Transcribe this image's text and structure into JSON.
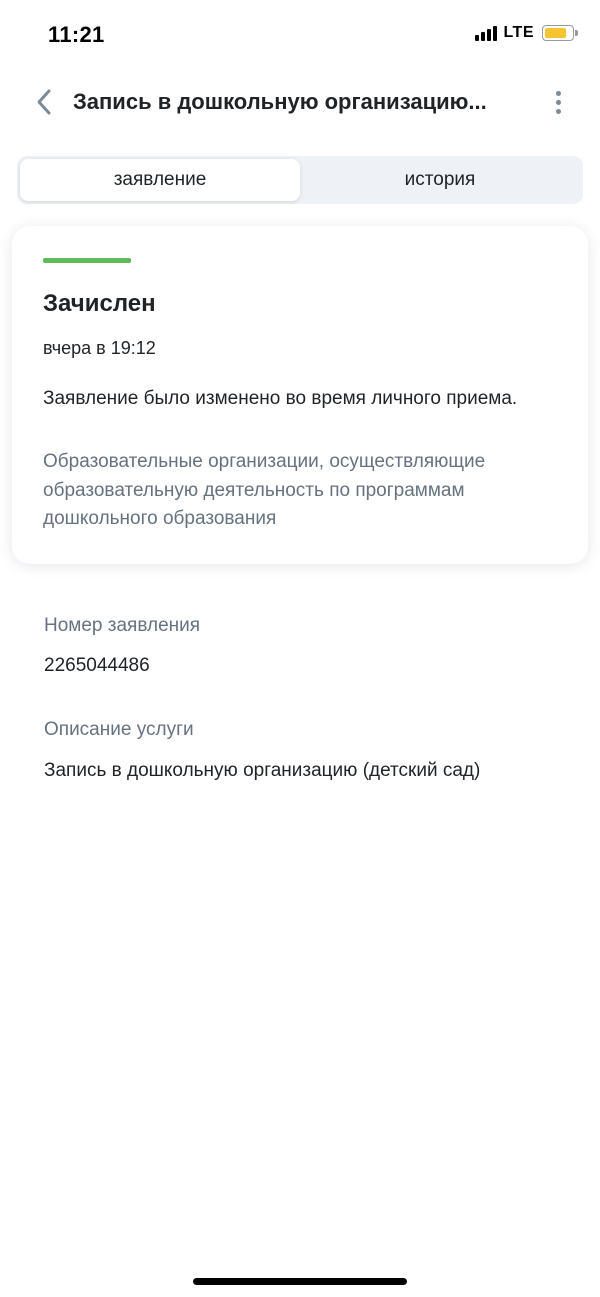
{
  "status_bar": {
    "time": "11:21",
    "network": "LTE",
    "battery_color": "#f5c430"
  },
  "header": {
    "title": "Запись в дошкольную организацию..."
  },
  "tabs": [
    {
      "label": "заявление",
      "active": true
    },
    {
      "label": "история",
      "active": false
    }
  ],
  "status_card": {
    "accent_color": "#5dbb5a",
    "title": "Зачислен",
    "time": "вчера в 19:12",
    "note": "Заявление было изменено во время личного приема.",
    "organization": "Образовательные организации, осуществляющие образовательную деятельность по программам дошкольного образования"
  },
  "details": {
    "number_label": "Номер заявления",
    "number_value": "2265044486",
    "service_label": "Описание услуги",
    "service_value": "Запись в дошкольную организацию (детский сад)"
  },
  "icons": {
    "back": "chevron-left-icon",
    "more": "more-vertical-icon",
    "signal": "signal-icon",
    "battery": "battery-icon"
  }
}
